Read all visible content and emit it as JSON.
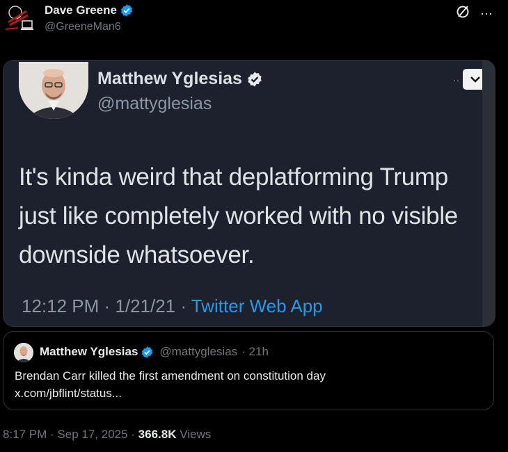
{
  "author": {
    "name": "Dave Greene",
    "handle": "@GreeneMan6"
  },
  "actions": {
    "grok_icon": "slash-circle-icon",
    "more_label": "···"
  },
  "media": {
    "name": "Matthew Yglesias",
    "handle": "@mattyglesias",
    "chevron_icon": "chevron-down-icon",
    "dots": "··",
    "text": "It's kinda weird that deplatforming Trump just like completely worked with no visible downside whatsoever.",
    "time_date": "12:12 PM · 1/21/21 · ",
    "app": "Twitter Web App"
  },
  "quote": {
    "name": "Matthew Yglesias",
    "handle": "@mattyglesias",
    "time": "· 21h",
    "text_line1": "Brendan Carr killed the first amendment on constitution day",
    "text_line2": "x.com/jbflint/status..."
  },
  "footer": {
    "time_date": "8:17 PM · Sep 17, 2025 · ",
    "views_count": "366.8K",
    "views_label": " Views"
  },
  "colors": {
    "verified": "#1d9bf0",
    "link_blue": "#2c97e6",
    "muted": "#71767b"
  }
}
